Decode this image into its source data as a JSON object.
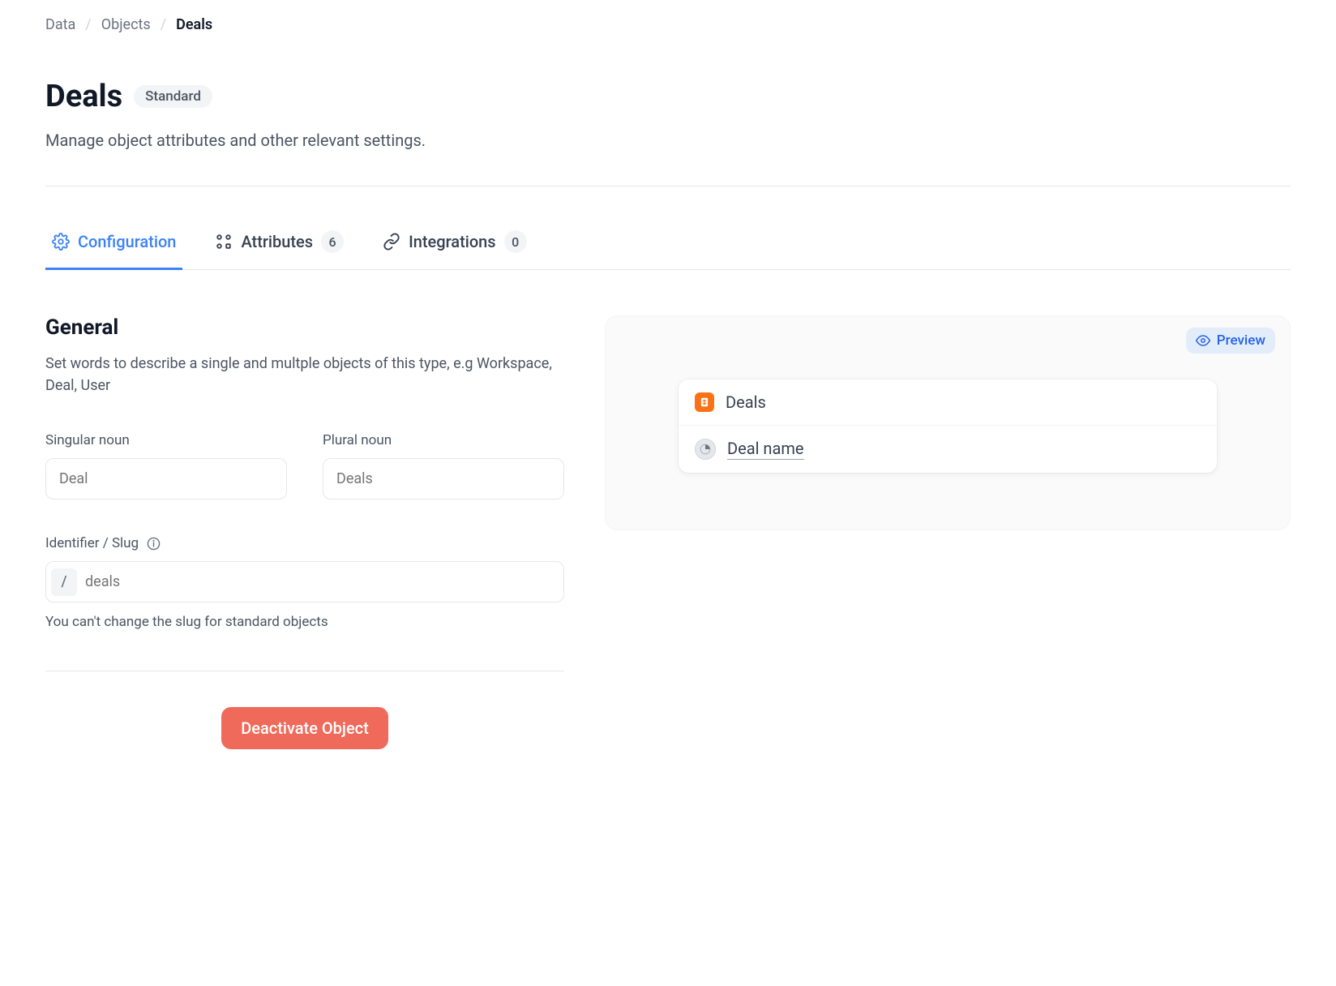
{
  "breadcrumb": {
    "items": [
      "Data",
      "Objects"
    ],
    "current": "Deals"
  },
  "header": {
    "title": "Deals",
    "badge": "Standard",
    "subtitle": "Manage object attributes and other relevant settings."
  },
  "tabs": [
    {
      "label": "Configuration",
      "icon": "gear-icon",
      "active": true
    },
    {
      "label": "Attributes",
      "icon": "grid-icon",
      "count": "6",
      "active": false
    },
    {
      "label": "Integrations",
      "icon": "link-icon",
      "count": "0",
      "active": false
    }
  ],
  "general": {
    "title": "General",
    "description": "Set words to describe a single and multple objects of this type, e.g Workspace, Deal, User",
    "singular": {
      "label": "Singular noun",
      "placeholder": "Deal",
      "value": ""
    },
    "plural": {
      "label": "Plural noun",
      "placeholder": "Deals",
      "value": ""
    },
    "slug": {
      "label": "Identifier / Slug",
      "prefix": "/",
      "placeholder": "deals",
      "value": "",
      "hint": "You can't change the slug for standard objects"
    }
  },
  "deactivate": {
    "label": "Deactivate Object"
  },
  "preview": {
    "badge": "Preview",
    "header": "Deals",
    "item": "Deal name"
  }
}
